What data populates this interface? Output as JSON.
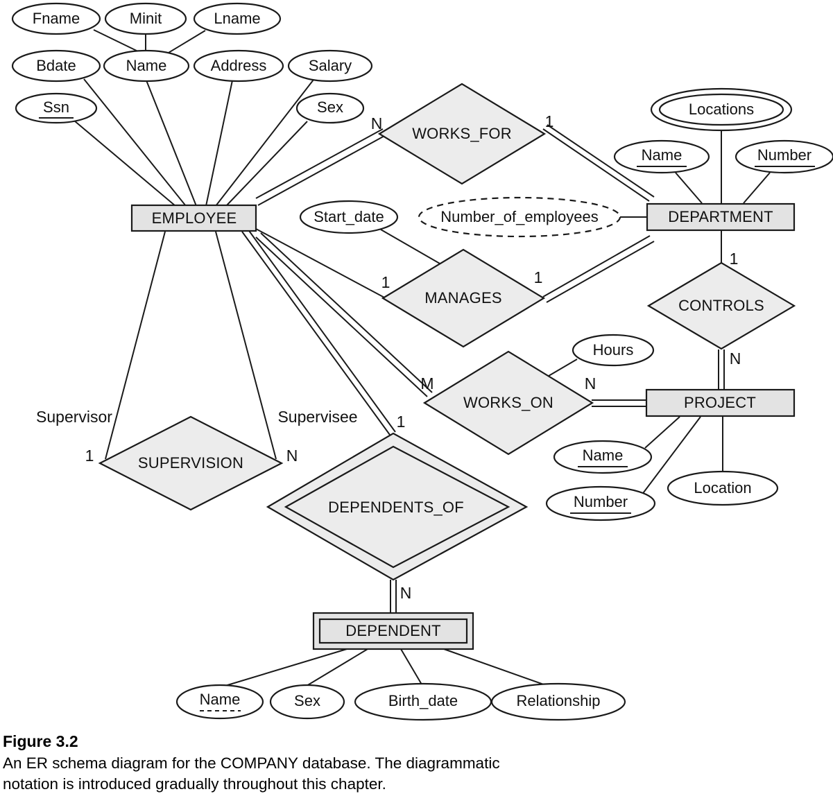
{
  "figure": {
    "title": "Figure 3.2",
    "caption": "An ER schema diagram for the COMPANY database. The diagrammatic notation is introduced gradually throughout this chapter."
  },
  "colors": {
    "entity_fill": "#e3e3e3",
    "relationship_fill": "#ececec",
    "attribute_fill": "#ffffff",
    "stroke": "#1a1a1a"
  },
  "diagram": {
    "type": "er-schema",
    "entities": [
      {
        "id": "employee",
        "label": "EMPLOYEE",
        "weak": false
      },
      {
        "id": "department",
        "label": "DEPARTMENT",
        "weak": false
      },
      {
        "id": "project",
        "label": "PROJECT",
        "weak": false
      },
      {
        "id": "dependent",
        "label": "DEPENDENT",
        "weak": true
      }
    ],
    "relationships": [
      {
        "id": "works_for",
        "label": "WORKS_FOR",
        "identifying": false
      },
      {
        "id": "manages",
        "label": "MANAGES",
        "identifying": false
      },
      {
        "id": "works_on",
        "label": "WORKS_ON",
        "identifying": false
      },
      {
        "id": "controls",
        "label": "CONTROLS",
        "identifying": false
      },
      {
        "id": "supervision",
        "label": "SUPERVISION",
        "identifying": false
      },
      {
        "id": "dependents_of",
        "label": "DEPENDENTS_OF",
        "identifying": true
      }
    ],
    "attributes": {
      "employee": [
        {
          "id": "fname",
          "label": "Fname",
          "kind": "simple"
        },
        {
          "id": "minit",
          "label": "Minit",
          "kind": "simple"
        },
        {
          "id": "lname",
          "label": "Lname",
          "kind": "simple"
        },
        {
          "id": "name",
          "label": "Name",
          "kind": "composite"
        },
        {
          "id": "bdate",
          "label": "Bdate",
          "kind": "simple"
        },
        {
          "id": "address",
          "label": "Address",
          "kind": "simple"
        },
        {
          "id": "salary",
          "label": "Salary",
          "kind": "simple"
        },
        {
          "id": "ssn",
          "label": "Ssn",
          "kind": "key"
        },
        {
          "id": "sex",
          "label": "Sex",
          "kind": "simple"
        }
      ],
      "department": [
        {
          "id": "dept_locations",
          "label": "Locations",
          "kind": "multivalued"
        },
        {
          "id": "dept_name",
          "label": "Name",
          "kind": "key"
        },
        {
          "id": "dept_number",
          "label": "Number",
          "kind": "key"
        },
        {
          "id": "num_employees",
          "label": "Number_of_employees",
          "kind": "derived"
        }
      ],
      "project": [
        {
          "id": "proj_name",
          "label": "Name",
          "kind": "key"
        },
        {
          "id": "proj_number",
          "label": "Number",
          "kind": "key"
        },
        {
          "id": "proj_location",
          "label": "Location",
          "kind": "simple"
        }
      ],
      "dependent": [
        {
          "id": "dep_name",
          "label": "Name",
          "kind": "partial-key"
        },
        {
          "id": "dep_sex",
          "label": "Sex",
          "kind": "simple"
        },
        {
          "id": "dep_birth_date",
          "label": "Birth_date",
          "kind": "simple"
        },
        {
          "id": "dep_relationship",
          "label": "Relationship",
          "kind": "simple"
        }
      ],
      "manages": [
        {
          "id": "start_date",
          "label": "Start_date",
          "kind": "simple"
        }
      ],
      "works_on": [
        {
          "id": "hours",
          "label": "Hours",
          "kind": "simple"
        }
      ]
    },
    "cardinalities": {
      "works_for_employee": "N",
      "works_for_department": "1",
      "manages_employee": "1",
      "manages_department": "1",
      "works_on_employee": "M",
      "works_on_project": "N",
      "controls_department": "1",
      "controls_project": "N",
      "supervision_supervisor": "1",
      "supervision_supervisee": "N",
      "dependents_of_employee": "1",
      "dependents_of_dependent": "N"
    },
    "roles": {
      "supervisor": "Supervisor",
      "supervisee": "Supervisee"
    }
  }
}
